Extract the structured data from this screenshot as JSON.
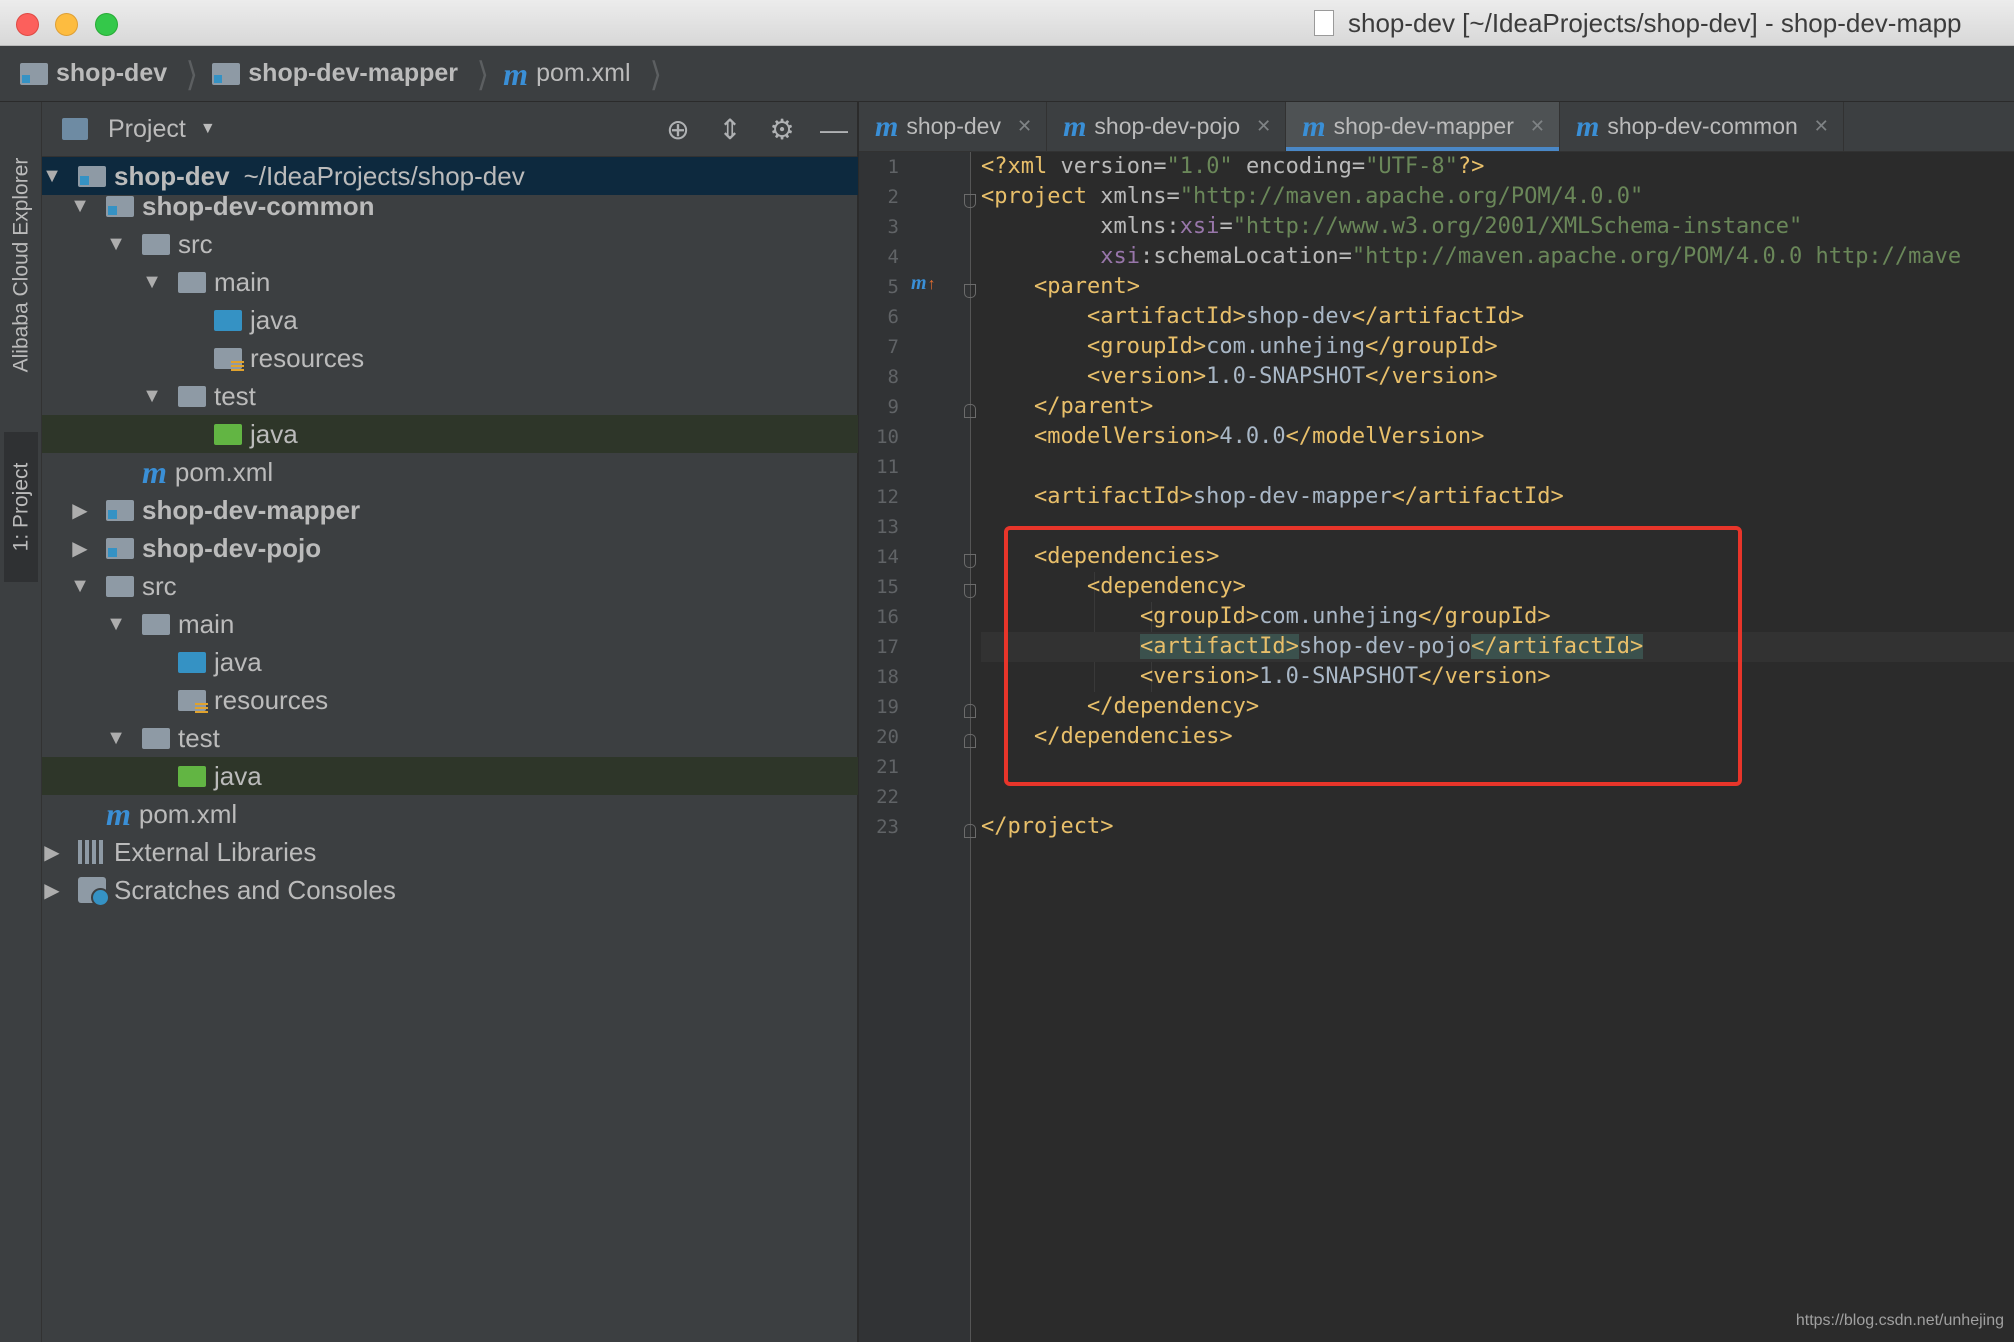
{
  "window": {
    "title": "shop-dev [~/IdeaProjects/shop-dev] - shop-dev-mapp"
  },
  "breadcrumbs": [
    {
      "label": "shop-dev",
      "icon": "module-folder-icon"
    },
    {
      "label": "shop-dev-mapper",
      "icon": "module-folder-icon"
    },
    {
      "label": "pom.xml",
      "icon": "maven-icon"
    }
  ],
  "side_tabs": {
    "cloud_explorer": "Alibaba Cloud Explorer",
    "project": "1: Project"
  },
  "project_panel": {
    "title": "Project",
    "tree": [
      {
        "label": "shop-dev",
        "extra": "~/IdeaProjects/shop-dev",
        "bold": true
      },
      {
        "label": "shop-dev-common",
        "bold": true
      },
      {
        "label": "src"
      },
      {
        "label": "main"
      },
      {
        "label": "java"
      },
      {
        "label": "resources"
      },
      {
        "label": "test"
      },
      {
        "label": "java"
      },
      {
        "label": "pom.xml"
      },
      {
        "label": "shop-dev-mapper",
        "bold": true
      },
      {
        "label": "shop-dev-pojo",
        "bold": true
      },
      {
        "label": "src"
      },
      {
        "label": "main"
      },
      {
        "label": "java"
      },
      {
        "label": "resources"
      },
      {
        "label": "test"
      },
      {
        "label": "java"
      },
      {
        "label": "pom.xml"
      },
      {
        "label": "External Libraries"
      },
      {
        "label": "Scratches and Consoles"
      }
    ]
  },
  "editor": {
    "tabs": [
      {
        "label": "shop-dev"
      },
      {
        "label": "shop-dev-pojo"
      },
      {
        "label": "shop-dev-mapper",
        "active": true
      },
      {
        "label": "shop-dev-common"
      }
    ],
    "line_numbers": [
      "1",
      "2",
      "3",
      "4",
      "5",
      "6",
      "7",
      "8",
      "9",
      "10",
      "11",
      "12",
      "13",
      "14",
      "15",
      "16",
      "17",
      "18",
      "19",
      "20",
      "21",
      "22",
      "23"
    ],
    "lines": [
      "<?xml version=\"1.0\" encoding=\"UTF-8\"?>",
      "<project xmlns=\"http://maven.apache.org/POM/4.0.0\"",
      "         xmlns:xsi=\"http://www.w3.org/2001/XMLSchema-instance\"",
      "         xsi:schemaLocation=\"http://maven.apache.org/POM/4.0.0 http://mave",
      "    <parent>",
      "        <artifactId>shop-dev</artifactId>",
      "        <groupId>com.unhejing</groupId>",
      "        <version>1.0-SNAPSHOT</version>",
      "    </parent>",
      "    <modelVersion>4.0.0</modelVersion>",
      "",
      "    <artifactId>shop-dev-mapper</artifactId>",
      "",
      "    <dependencies>",
      "        <dependency>",
      "            <groupId>com.unhejing</groupId>",
      "            <artifactId>shop-dev-pojo</artifactId>",
      "            <version>1.0-SNAPSHOT</version>",
      "        </dependency>",
      "    </dependencies>",
      "",
      "",
      "</project>"
    ]
  },
  "watermark": "https://blog.csdn.net/unhejing",
  "colors": {
    "highlight_box": "#e8352a",
    "accent": "#4a88c7"
  }
}
